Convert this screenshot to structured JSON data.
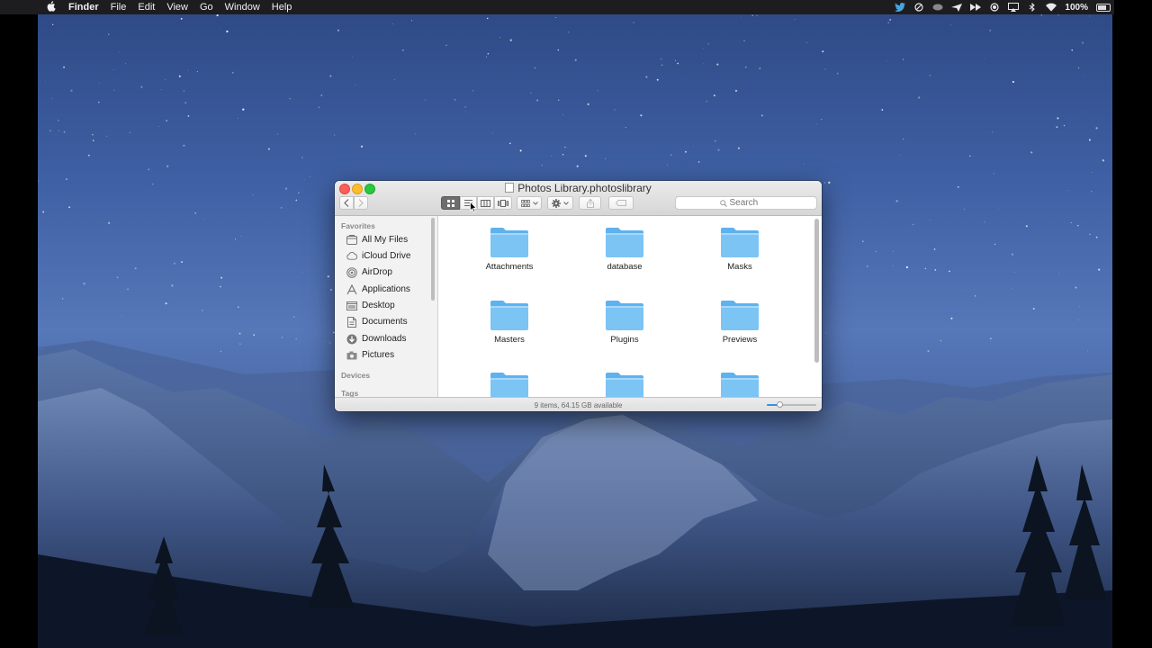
{
  "menubar": {
    "apple": "",
    "items": [
      "Finder",
      "File",
      "Edit",
      "View",
      "Go",
      "Window",
      "Help"
    ],
    "battery_text": "100%"
  },
  "window": {
    "title": "Photos Library.photoslibrary",
    "search_placeholder": "Search",
    "status": "9 items, 64.15 GB available",
    "icon_size_level": 0.25
  },
  "sidebar": {
    "favorites_header": "Favorites",
    "devices_header": "Devices",
    "tags_header": "Tags",
    "items": [
      {
        "label": "All My Files",
        "icon": "all-files-icon"
      },
      {
        "label": "iCloud Drive",
        "icon": "cloud-icon"
      },
      {
        "label": "AirDrop",
        "icon": "airdrop-icon"
      },
      {
        "label": "Applications",
        "icon": "applications-icon"
      },
      {
        "label": "Desktop",
        "icon": "desktop-icon"
      },
      {
        "label": "Documents",
        "icon": "documents-icon"
      },
      {
        "label": "Downloads",
        "icon": "downloads-icon"
      },
      {
        "label": "Pictures",
        "icon": "pictures-icon"
      }
    ]
  },
  "folders": [
    {
      "name": "Attachments"
    },
    {
      "name": "database"
    },
    {
      "name": "Masks"
    },
    {
      "name": "Masters"
    },
    {
      "name": "Plugins"
    },
    {
      "name": "Previews"
    },
    {
      "name": ""
    },
    {
      "name": ""
    },
    {
      "name": ""
    }
  ],
  "colors": {
    "folder": "#7cc4f4",
    "folder_tab": "#5eb2ee",
    "menubar": "#1d1d1f",
    "accent": "#3a8ee6"
  }
}
